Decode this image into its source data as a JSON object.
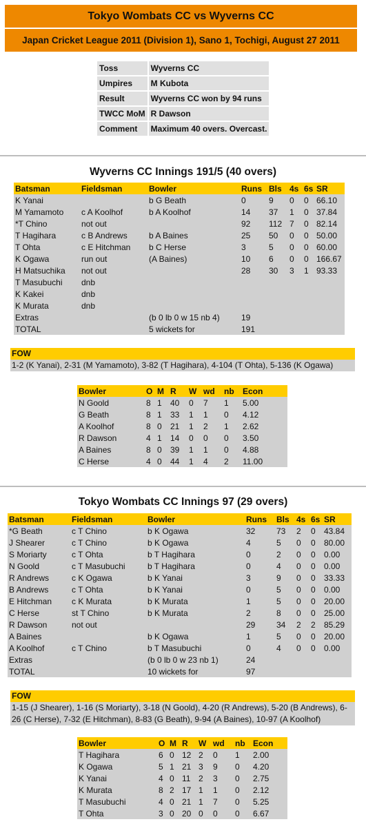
{
  "header": {
    "title": "Tokyo Wombats CC vs Wyverns CC",
    "subtitle": "Japan Cricket League 2011 (Division 1), Sano 1, Tochigi, August 27 2011"
  },
  "info": [
    {
      "label": "Toss",
      "value": "Wyverns CC"
    },
    {
      "label": "Umpires",
      "value": "M Kubota"
    },
    {
      "label": "Result",
      "value": "Wyverns CC won by 94 runs"
    },
    {
      "label": "TWCC MoM",
      "value": "R Dawson"
    },
    {
      "label": "Comment",
      "value": "Maximum 40 overs. Overcast."
    }
  ],
  "colors": {
    "banner": "#ee8800",
    "header_row": "#ffcc00",
    "row_bg": "#d0d0d0",
    "info_bg": "#e0e0e0"
  },
  "innings": [
    {
      "title": "Wyverns CC Innings 191/5 (40 overs)",
      "batting_headers": [
        "Batsman",
        "Fieldsman",
        "Bowler",
        "Runs",
        "Bls",
        "4s",
        "6s",
        "SR"
      ],
      "batting": [
        [
          "K Yanai",
          "",
          "b G Beath",
          "0",
          "9",
          "0",
          "0",
          "66.10"
        ],
        [
          "M Yamamoto",
          "c A Koolhof",
          "b A Koolhof",
          "14",
          "37",
          "1",
          "0",
          "37.84"
        ],
        [
          "*T Chino",
          "not out",
          "",
          "92",
          "112",
          "7",
          "0",
          "82.14"
        ],
        [
          "T Hagihara",
          "c B Andrews",
          "b A Baines",
          "25",
          "50",
          "0",
          "0",
          "50.00"
        ],
        [
          "T Ohta",
          "c E Hitchman",
          "b C Herse",
          "3",
          "5",
          "0",
          "0",
          "60.00"
        ],
        [
          "K Ogawa",
          "run out",
          "(A Baines)",
          "10",
          "6",
          "0",
          "0",
          "166.67"
        ],
        [
          "H Matsuchika",
          "not out",
          "",
          "28",
          "30",
          "3",
          "1",
          "93.33"
        ],
        [
          "T Masubuchi",
          "dnb",
          "",
          "",
          "",
          "",
          "",
          ""
        ],
        [
          "K Kakei",
          "dnb",
          "",
          "",
          "",
          "",
          "",
          ""
        ],
        [
          "K Murata",
          "dnb",
          "",
          "",
          "",
          "",
          "",
          ""
        ],
        [
          "Extras",
          "",
          "(b 0 lb 0 w 15 nb 4)",
          "19",
          "",
          "",
          "",
          ""
        ],
        [
          "TOTAL",
          "",
          "5 wickets for",
          "191",
          "",
          "",
          "",
          ""
        ]
      ],
      "fow_label": "FOW",
      "fow": "1-2 (K Yanai), 2-31 (M Yamamoto), 3-82 (T Hagihara), 4-104 (T Ohta), 5-136 (K Ogawa)",
      "bowling_headers": [
        "Bowler",
        "O",
        "M",
        "R",
        "W",
        "wd",
        "nb",
        "Econ"
      ],
      "bowling": [
        [
          "N Goold",
          "8",
          "1",
          "40",
          "0",
          "7",
          "1",
          "5.00"
        ],
        [
          "G Beath",
          "8",
          "1",
          "33",
          "1",
          "1",
          "0",
          "4.12"
        ],
        [
          "A Koolhof",
          "8",
          "0",
          "21",
          "1",
          "2",
          "1",
          "2.62"
        ],
        [
          "R Dawson",
          "4",
          "1",
          "14",
          "0",
          "0",
          "0",
          "3.50"
        ],
        [
          "A Baines",
          "8",
          "0",
          "39",
          "1",
          "1",
          "0",
          "4.88"
        ],
        [
          "C Herse",
          "4",
          "0",
          "44",
          "1",
          "4",
          "2",
          "11.00"
        ]
      ]
    },
    {
      "title": "Tokyo Wombats CC Innings 97 (29 overs)",
      "batting_headers": [
        "Batsman",
        "Fieldsman",
        "Bowler",
        "Runs",
        "Bls",
        "4s",
        "6s",
        "SR"
      ],
      "batting": [
        [
          "*G Beath",
          "c T Chino",
          "b K Ogawa",
          "32",
          "73",
          "2",
          "0",
          "43.84"
        ],
        [
          "J Shearer",
          "c T Chino",
          "b K Ogawa",
          "4",
          "5",
          "0",
          "0",
          "80.00"
        ],
        [
          "S Moriarty",
          "c T Ohta",
          "b T Hagihara",
          "0",
          "2",
          "0",
          "0",
          "0.00"
        ],
        [
          "N Goold",
          "c T Masubuchi",
          "b T Hagihara",
          "0",
          "4",
          "0",
          "0",
          "0.00"
        ],
        [
          "R Andrews",
          "c K Ogawa",
          "b K Yanai",
          "3",
          "9",
          "0",
          "0",
          "33.33"
        ],
        [
          "B Andrews",
          "c T Ohta",
          "b K Yanai",
          "0",
          "5",
          "0",
          "0",
          "0.00"
        ],
        [
          "E Hitchman",
          "c K Murata",
          "b K Murata",
          "1",
          "5",
          "0",
          "0",
          "20.00"
        ],
        [
          "C Herse",
          "st T Chino",
          "b K Murata",
          "2",
          "8",
          "0",
          "0",
          "25.00"
        ],
        [
          "R Dawson",
          "not out",
          "",
          "29",
          "34",
          "2",
          "2",
          "85.29"
        ],
        [
          "A Baines",
          "",
          "b K Ogawa",
          "1",
          "5",
          "0",
          "0",
          "20.00"
        ],
        [
          "A Koolhof",
          "c T Chino",
          "b T Masubuchi",
          "0",
          "4",
          "0",
          "0",
          "0.00"
        ],
        [
          "Extras",
          "",
          "(b 0 lb 0 w 23 nb 1)",
          "24",
          "",
          "",
          "",
          ""
        ],
        [
          "TOTAL",
          "",
          "10 wickets for",
          "97",
          "",
          "",
          "",
          ""
        ]
      ],
      "fow_label": "FOW",
      "fow": "1-15 (J Shearer), 1-16 (S Moriarty), 3-18 (N Goold), 4-20 (R Andrews), 5-20 (B Andrews), 6-26 (C Herse), 7-32 (E Hitchman), 8-83 (G Beath), 9-94 (A Baines), 10-97 (A Koolhof)",
      "bowling_headers": [
        "Bowler",
        "O",
        "M",
        "R",
        "W",
        "wd",
        "nb",
        "Econ"
      ],
      "bowling": [
        [
          "T Hagihara",
          "6",
          "0",
          "12",
          "2",
          "0",
          "1",
          "2.00"
        ],
        [
          "K Ogawa",
          "5",
          "1",
          "21",
          "3",
          "9",
          "0",
          "4.20"
        ],
        [
          "K Yanai",
          "4",
          "0",
          "11",
          "2",
          "3",
          "0",
          "2.75"
        ],
        [
          "K Murata",
          "8",
          "2",
          "17",
          "1",
          "1",
          "0",
          "2.12"
        ],
        [
          "T Masubuchi",
          "4",
          "0",
          "21",
          "1",
          "7",
          "0",
          "5.25"
        ],
        [
          "T Ohta",
          "3",
          "0",
          "20",
          "0",
          "0",
          "0",
          "6.67"
        ]
      ]
    }
  ]
}
